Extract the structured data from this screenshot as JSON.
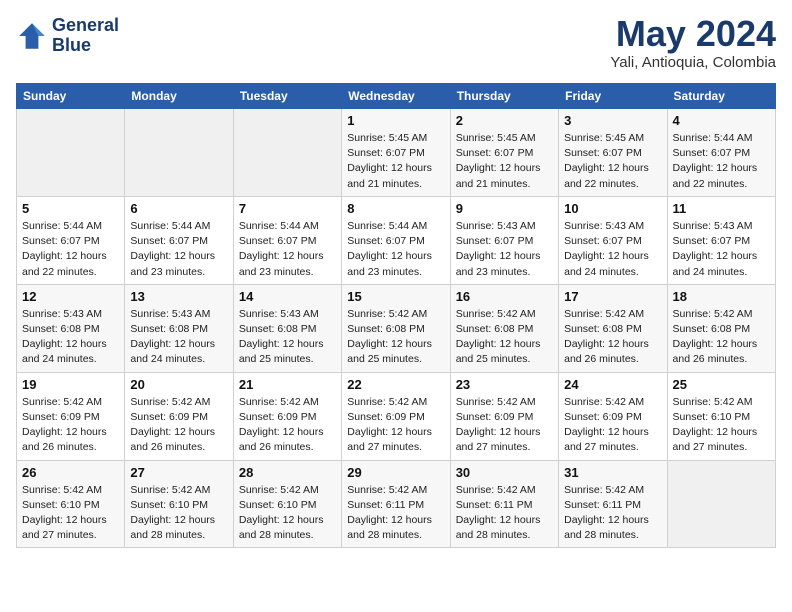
{
  "header": {
    "logo_line1": "General",
    "logo_line2": "Blue",
    "month": "May 2024",
    "location": "Yali, Antioquia, Colombia"
  },
  "days_of_week": [
    "Sunday",
    "Monday",
    "Tuesday",
    "Wednesday",
    "Thursday",
    "Friday",
    "Saturday"
  ],
  "weeks": [
    [
      {
        "day": "",
        "info": ""
      },
      {
        "day": "",
        "info": ""
      },
      {
        "day": "",
        "info": ""
      },
      {
        "day": "1",
        "info": "Sunrise: 5:45 AM\nSunset: 6:07 PM\nDaylight: 12 hours\nand 21 minutes."
      },
      {
        "day": "2",
        "info": "Sunrise: 5:45 AM\nSunset: 6:07 PM\nDaylight: 12 hours\nand 21 minutes."
      },
      {
        "day": "3",
        "info": "Sunrise: 5:45 AM\nSunset: 6:07 PM\nDaylight: 12 hours\nand 22 minutes."
      },
      {
        "day": "4",
        "info": "Sunrise: 5:44 AM\nSunset: 6:07 PM\nDaylight: 12 hours\nand 22 minutes."
      }
    ],
    [
      {
        "day": "5",
        "info": "Sunrise: 5:44 AM\nSunset: 6:07 PM\nDaylight: 12 hours\nand 22 minutes."
      },
      {
        "day": "6",
        "info": "Sunrise: 5:44 AM\nSunset: 6:07 PM\nDaylight: 12 hours\nand 23 minutes."
      },
      {
        "day": "7",
        "info": "Sunrise: 5:44 AM\nSunset: 6:07 PM\nDaylight: 12 hours\nand 23 minutes."
      },
      {
        "day": "8",
        "info": "Sunrise: 5:44 AM\nSunset: 6:07 PM\nDaylight: 12 hours\nand 23 minutes."
      },
      {
        "day": "9",
        "info": "Sunrise: 5:43 AM\nSunset: 6:07 PM\nDaylight: 12 hours\nand 23 minutes."
      },
      {
        "day": "10",
        "info": "Sunrise: 5:43 AM\nSunset: 6:07 PM\nDaylight: 12 hours\nand 24 minutes."
      },
      {
        "day": "11",
        "info": "Sunrise: 5:43 AM\nSunset: 6:07 PM\nDaylight: 12 hours\nand 24 minutes."
      }
    ],
    [
      {
        "day": "12",
        "info": "Sunrise: 5:43 AM\nSunset: 6:08 PM\nDaylight: 12 hours\nand 24 minutes."
      },
      {
        "day": "13",
        "info": "Sunrise: 5:43 AM\nSunset: 6:08 PM\nDaylight: 12 hours\nand 24 minutes."
      },
      {
        "day": "14",
        "info": "Sunrise: 5:43 AM\nSunset: 6:08 PM\nDaylight: 12 hours\nand 25 minutes."
      },
      {
        "day": "15",
        "info": "Sunrise: 5:42 AM\nSunset: 6:08 PM\nDaylight: 12 hours\nand 25 minutes."
      },
      {
        "day": "16",
        "info": "Sunrise: 5:42 AM\nSunset: 6:08 PM\nDaylight: 12 hours\nand 25 minutes."
      },
      {
        "day": "17",
        "info": "Sunrise: 5:42 AM\nSunset: 6:08 PM\nDaylight: 12 hours\nand 26 minutes."
      },
      {
        "day": "18",
        "info": "Sunrise: 5:42 AM\nSunset: 6:08 PM\nDaylight: 12 hours\nand 26 minutes."
      }
    ],
    [
      {
        "day": "19",
        "info": "Sunrise: 5:42 AM\nSunset: 6:09 PM\nDaylight: 12 hours\nand 26 minutes."
      },
      {
        "day": "20",
        "info": "Sunrise: 5:42 AM\nSunset: 6:09 PM\nDaylight: 12 hours\nand 26 minutes."
      },
      {
        "day": "21",
        "info": "Sunrise: 5:42 AM\nSunset: 6:09 PM\nDaylight: 12 hours\nand 26 minutes."
      },
      {
        "day": "22",
        "info": "Sunrise: 5:42 AM\nSunset: 6:09 PM\nDaylight: 12 hours\nand 27 minutes."
      },
      {
        "day": "23",
        "info": "Sunrise: 5:42 AM\nSunset: 6:09 PM\nDaylight: 12 hours\nand 27 minutes."
      },
      {
        "day": "24",
        "info": "Sunrise: 5:42 AM\nSunset: 6:09 PM\nDaylight: 12 hours\nand 27 minutes."
      },
      {
        "day": "25",
        "info": "Sunrise: 5:42 AM\nSunset: 6:10 PM\nDaylight: 12 hours\nand 27 minutes."
      }
    ],
    [
      {
        "day": "26",
        "info": "Sunrise: 5:42 AM\nSunset: 6:10 PM\nDaylight: 12 hours\nand 27 minutes."
      },
      {
        "day": "27",
        "info": "Sunrise: 5:42 AM\nSunset: 6:10 PM\nDaylight: 12 hours\nand 28 minutes."
      },
      {
        "day": "28",
        "info": "Sunrise: 5:42 AM\nSunset: 6:10 PM\nDaylight: 12 hours\nand 28 minutes."
      },
      {
        "day": "29",
        "info": "Sunrise: 5:42 AM\nSunset: 6:11 PM\nDaylight: 12 hours\nand 28 minutes."
      },
      {
        "day": "30",
        "info": "Sunrise: 5:42 AM\nSunset: 6:11 PM\nDaylight: 12 hours\nand 28 minutes."
      },
      {
        "day": "31",
        "info": "Sunrise: 5:42 AM\nSunset: 6:11 PM\nDaylight: 12 hours\nand 28 minutes."
      },
      {
        "day": "",
        "info": ""
      }
    ]
  ]
}
